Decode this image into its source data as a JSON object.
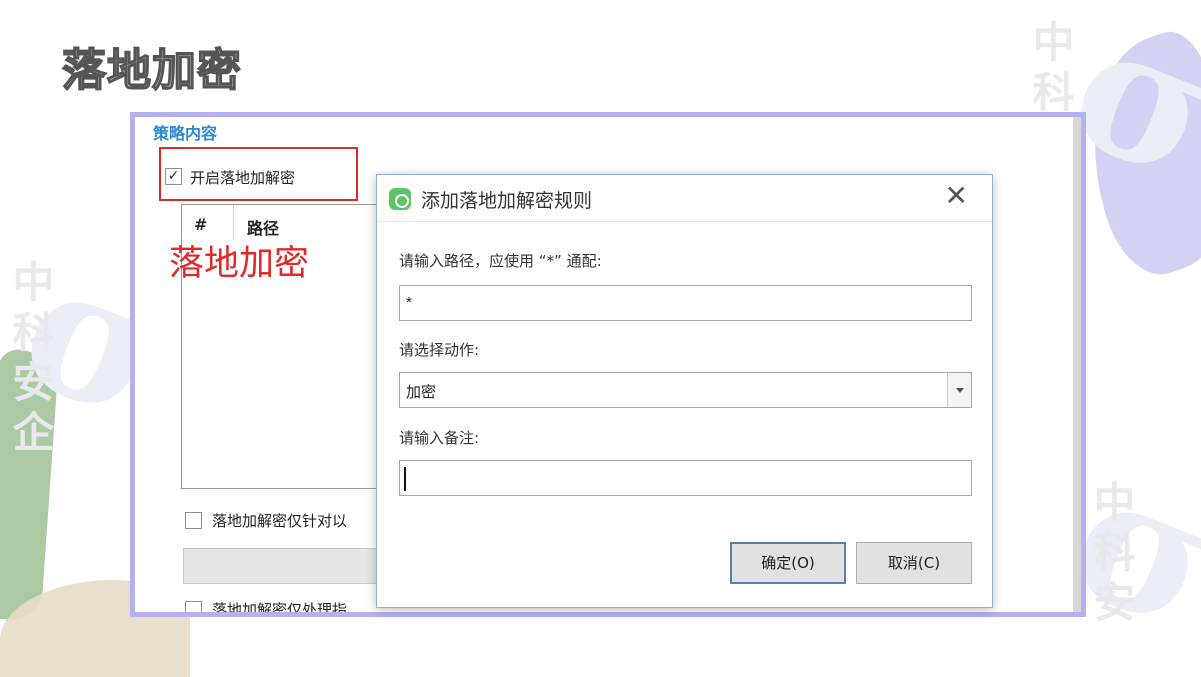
{
  "slide": {
    "title": "落地加密",
    "watermark_text": "中科安企",
    "watermark_logo": "σ"
  },
  "policy_window": {
    "section_label": "策略内容",
    "enable_checkbox": {
      "checked": true,
      "mark": "✓",
      "label": "开启落地加解密"
    },
    "list": {
      "columns": [
        "#",
        "路径"
      ]
    },
    "annotation": "落地加密",
    "option_b": {
      "checked": false,
      "label": "落地加解密仅针对以"
    },
    "option_c": {
      "checked": false,
      "label": "落地加解密仅处理指"
    }
  },
  "dialog": {
    "title": "添加落地加解密规则",
    "close_glyph": "✕",
    "path_label": "请输入路径，应使用 “*” 通配:",
    "path_value": "*",
    "action_label": "请选择动作:",
    "action_value": "加密",
    "note_label": "请输入备注:",
    "note_value": "",
    "ok_button": "确定(O)",
    "cancel_button": "取消(C)"
  },
  "colors": {
    "frame_border": "#b5b1ee",
    "annotation_red": "#e02a2a",
    "section_blue": "#2b8ad0",
    "dialog_icon_green": "#5ec46a"
  }
}
